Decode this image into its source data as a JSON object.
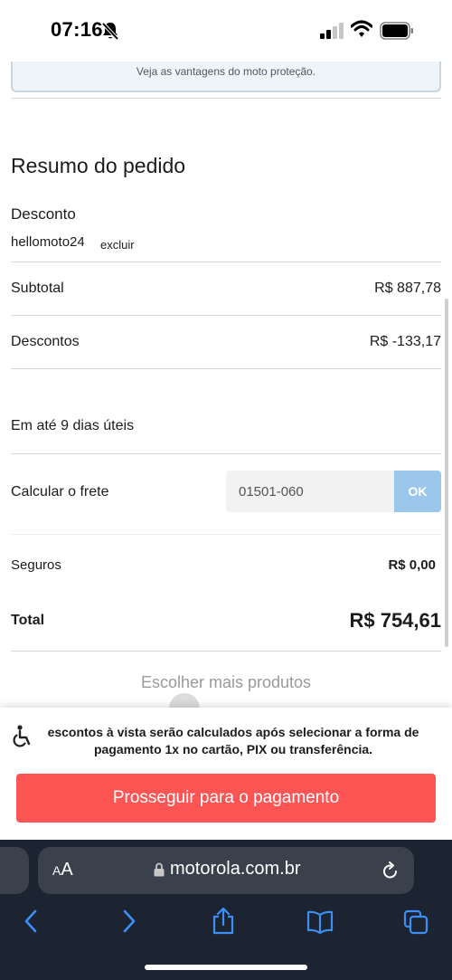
{
  "status_bar": {
    "time": "07:16"
  },
  "promo": {
    "text": "Veja as vantagens do moto proteção."
  },
  "summary": {
    "title": "Resumo do pedido",
    "discount_label": "Desconto",
    "coupon_code": "hellomoto24",
    "coupon_remove": "excluir",
    "subtotal_label": "Subtotal",
    "subtotal_value": "R$ 887,78",
    "discounts_label": "Descontos",
    "discounts_value": "R$ -133,17",
    "delivery_label": "Em até 9 dias úteis",
    "shipping_label": "Calcular o frete",
    "cep_value": "01501-060",
    "ok_label": "OK",
    "insurance_label": "Seguros",
    "insurance_value": "R$ 0,00",
    "total_label": "Total",
    "total_value": "R$ 754,61",
    "more_products": "Escolher mais produtos"
  },
  "footer": {
    "note": "escontos à vista serão calculados após selecionar a forma de pagamento 1x no cartão, PIX ou transferência.",
    "pay_button": "Prosseguir para o pagamento"
  },
  "browser": {
    "text_size_label_small": "A",
    "text_size_label_large": "A",
    "url": "motorola.com.br"
  },
  "colors": {
    "pay_button": "#fc5553",
    "ok_button": "#9cc7ec",
    "browser_toolbar": "#1c2331",
    "browser_icon": "#3b8ff5"
  },
  "icons": [
    "bell-slash-icon",
    "signal-icon",
    "wifi-icon",
    "battery-icon",
    "accessibility-icon",
    "lock-icon",
    "reload-icon",
    "back-icon",
    "forward-icon",
    "share-icon",
    "bookmarks-icon",
    "tabs-icon"
  ]
}
